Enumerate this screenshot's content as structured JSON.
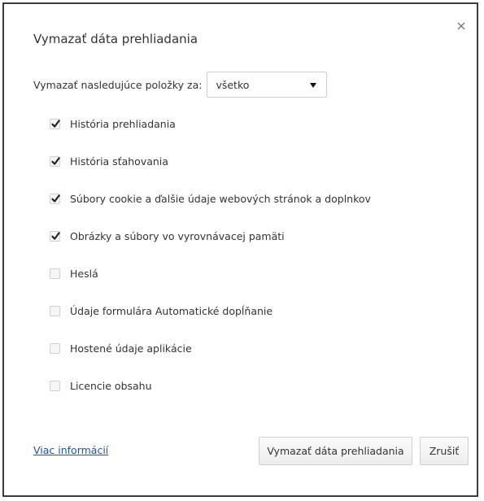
{
  "dialog": {
    "title": "Vymazať dáta prehliadania",
    "close_icon": "close-icon"
  },
  "range": {
    "label": "Vymazať nasledujúce položky za:",
    "selected": "všetko"
  },
  "options": [
    {
      "label": "História prehliadania",
      "checked": true
    },
    {
      "label": "História sťahovania",
      "checked": true
    },
    {
      "label": "Súbory cookie a ďalšie údaje webových stránok a doplnkov",
      "checked": true
    },
    {
      "label": "Obrázky a súbory vo vyrovnávacej pamäti",
      "checked": true
    },
    {
      "label": "Heslá",
      "checked": false
    },
    {
      "label": "Údaje formulára Automatické dopĺňanie",
      "checked": false
    },
    {
      "label": "Hostené údaje aplikácie",
      "checked": false
    },
    {
      "label": "Licencie obsahu",
      "checked": false
    }
  ],
  "footer": {
    "more_info_link": "Viac informácií",
    "clear_button": "Vymazať dáta prehliadania",
    "cancel_button": "Zrušiť"
  },
  "colors": {
    "link": "#1155cc",
    "border": "#3c3c3c",
    "text": "#333333"
  }
}
